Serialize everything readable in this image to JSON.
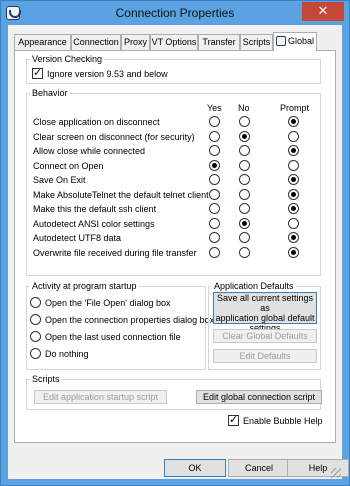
{
  "window": {
    "title": "Connection Properties",
    "close_glyph": "✕"
  },
  "tabs": [
    "Appearance",
    "Connection",
    "Proxy",
    "VT Options",
    "Transfer",
    "Scripts",
    "Global"
  ],
  "active_tab": "Global",
  "version_checking": {
    "title": "Version Checking",
    "ignore_label": "Ignore version 9.53 and below",
    "ignore_checked": true
  },
  "behavior": {
    "title": "Behavior",
    "columns": [
      "Yes",
      "No",
      "Prompt"
    ],
    "rows": [
      {
        "label": "Close application on disconnect",
        "selected": "prompt"
      },
      {
        "label": "Clear screen on disconnect (for security)",
        "selected": "no"
      },
      {
        "label": "Allow close while connected",
        "selected": "prompt"
      },
      {
        "label": "Connect on Open",
        "selected": "yes"
      },
      {
        "label": "Save On Exit",
        "selected": "prompt"
      },
      {
        "label": "Make AbsoluteTelnet the default telnet client",
        "selected": "prompt"
      },
      {
        "label": "Make this the default ssh client",
        "selected": "prompt"
      },
      {
        "label": "Autodetect ANSI color settings",
        "selected": "no"
      },
      {
        "label": "Autodetect UTF8 data",
        "selected": "prompt"
      },
      {
        "label": "Overwrite file received during file transfer",
        "selected": "prompt"
      }
    ]
  },
  "activity": {
    "title": "Activity at program startup",
    "options": [
      "Open the 'File Open' dialog box",
      "Open the connection properties dialog box",
      "Open the last used connection file",
      "Do nothing"
    ]
  },
  "app_defaults": {
    "title": "Application Defaults",
    "save_lines": [
      "Save all current settings as",
      "application global default",
      "settings"
    ],
    "clear_label": "Clear Global Defaults",
    "edit_label": "Edit Defaults"
  },
  "scripts": {
    "title": "Scripts",
    "startup_label": "Edit application startup script",
    "global_label": "Edit global connection script"
  },
  "bubble_help": {
    "label": "Enable Bubble Help",
    "checked": true
  },
  "buttons": {
    "ok": "OK",
    "cancel": "Cancel",
    "help": "Help"
  }
}
